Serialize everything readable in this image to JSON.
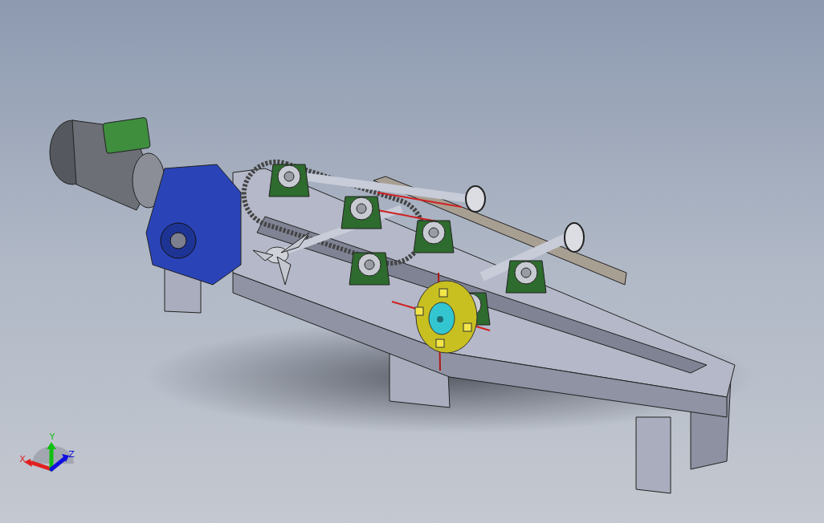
{
  "viewport": {
    "model": {
      "kind": "conveyor"
    },
    "triad": {
      "axes": [
        {
          "label": "X",
          "color": "#e02020"
        },
        {
          "label": "Y",
          "color": "#10c010"
        },
        {
          "label": "Z",
          "color": "#1010e0"
        }
      ]
    }
  }
}
